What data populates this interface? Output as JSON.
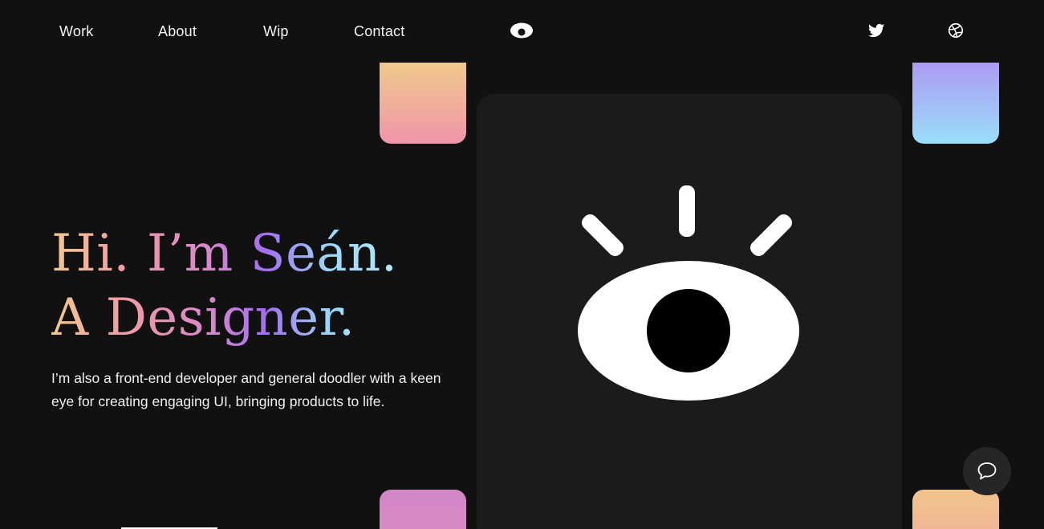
{
  "nav": {
    "items": [
      {
        "label": "Work"
      },
      {
        "label": "About"
      },
      {
        "label": "Wip"
      },
      {
        "label": "Contact"
      }
    ],
    "logo_icon": "eye-logo-icon",
    "social": [
      {
        "icon": "twitter-icon"
      },
      {
        "icon": "dribbble-icon"
      }
    ]
  },
  "hero": {
    "line1": "Hi. I’m Seán.",
    "line2": "A Designer.",
    "tagline": "I’m also a front-end developer and general doodler with a keen eye for creating engaging UI, bringing products to life."
  },
  "illustration": {
    "icon": "eye-illustration-icon"
  },
  "chat": {
    "icon": "chat-bubble-icon"
  },
  "colors": {
    "background": "#111111",
    "card": "#1b1b1b",
    "gradient": [
      "#f3c98e",
      "#f09aa8",
      "#d889c9",
      "#a26ef0",
      "#9ad8fa"
    ]
  }
}
